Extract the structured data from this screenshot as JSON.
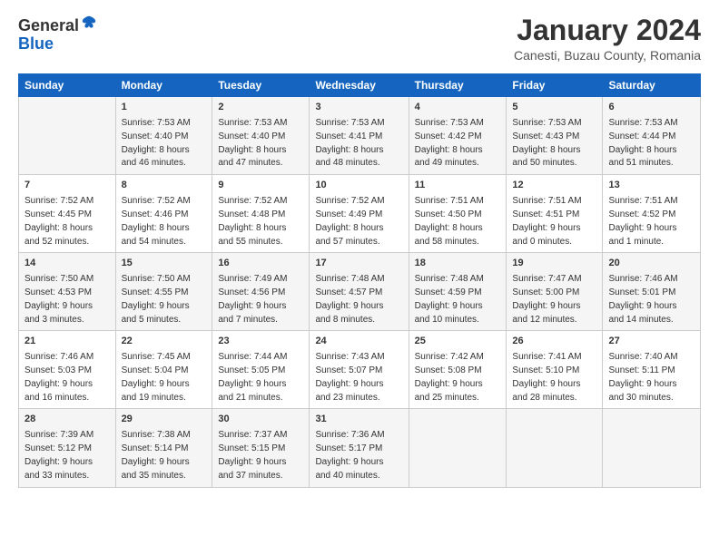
{
  "header": {
    "logo_line1": "General",
    "logo_line2": "Blue",
    "month": "January 2024",
    "location": "Canesti, Buzau County, Romania"
  },
  "days_of_week": [
    "Sunday",
    "Monday",
    "Tuesday",
    "Wednesday",
    "Thursday",
    "Friday",
    "Saturday"
  ],
  "weeks": [
    [
      {
        "day": "",
        "info": ""
      },
      {
        "day": "1",
        "info": "Sunrise: 7:53 AM\nSunset: 4:40 PM\nDaylight: 8 hours\nand 46 minutes."
      },
      {
        "day": "2",
        "info": "Sunrise: 7:53 AM\nSunset: 4:40 PM\nDaylight: 8 hours\nand 47 minutes."
      },
      {
        "day": "3",
        "info": "Sunrise: 7:53 AM\nSunset: 4:41 PM\nDaylight: 8 hours\nand 48 minutes."
      },
      {
        "day": "4",
        "info": "Sunrise: 7:53 AM\nSunset: 4:42 PM\nDaylight: 8 hours\nand 49 minutes."
      },
      {
        "day": "5",
        "info": "Sunrise: 7:53 AM\nSunset: 4:43 PM\nDaylight: 8 hours\nand 50 minutes."
      },
      {
        "day": "6",
        "info": "Sunrise: 7:53 AM\nSunset: 4:44 PM\nDaylight: 8 hours\nand 51 minutes."
      }
    ],
    [
      {
        "day": "7",
        "info": "Sunrise: 7:52 AM\nSunset: 4:45 PM\nDaylight: 8 hours\nand 52 minutes."
      },
      {
        "day": "8",
        "info": "Sunrise: 7:52 AM\nSunset: 4:46 PM\nDaylight: 8 hours\nand 54 minutes."
      },
      {
        "day": "9",
        "info": "Sunrise: 7:52 AM\nSunset: 4:48 PM\nDaylight: 8 hours\nand 55 minutes."
      },
      {
        "day": "10",
        "info": "Sunrise: 7:52 AM\nSunset: 4:49 PM\nDaylight: 8 hours\nand 57 minutes."
      },
      {
        "day": "11",
        "info": "Sunrise: 7:51 AM\nSunset: 4:50 PM\nDaylight: 8 hours\nand 58 minutes."
      },
      {
        "day": "12",
        "info": "Sunrise: 7:51 AM\nSunset: 4:51 PM\nDaylight: 9 hours\nand 0 minutes."
      },
      {
        "day": "13",
        "info": "Sunrise: 7:51 AM\nSunset: 4:52 PM\nDaylight: 9 hours\nand 1 minute."
      }
    ],
    [
      {
        "day": "14",
        "info": "Sunrise: 7:50 AM\nSunset: 4:53 PM\nDaylight: 9 hours\nand 3 minutes."
      },
      {
        "day": "15",
        "info": "Sunrise: 7:50 AM\nSunset: 4:55 PM\nDaylight: 9 hours\nand 5 minutes."
      },
      {
        "day": "16",
        "info": "Sunrise: 7:49 AM\nSunset: 4:56 PM\nDaylight: 9 hours\nand 7 minutes."
      },
      {
        "day": "17",
        "info": "Sunrise: 7:48 AM\nSunset: 4:57 PM\nDaylight: 9 hours\nand 8 minutes."
      },
      {
        "day": "18",
        "info": "Sunrise: 7:48 AM\nSunset: 4:59 PM\nDaylight: 9 hours\nand 10 minutes."
      },
      {
        "day": "19",
        "info": "Sunrise: 7:47 AM\nSunset: 5:00 PM\nDaylight: 9 hours\nand 12 minutes."
      },
      {
        "day": "20",
        "info": "Sunrise: 7:46 AM\nSunset: 5:01 PM\nDaylight: 9 hours\nand 14 minutes."
      }
    ],
    [
      {
        "day": "21",
        "info": "Sunrise: 7:46 AM\nSunset: 5:03 PM\nDaylight: 9 hours\nand 16 minutes."
      },
      {
        "day": "22",
        "info": "Sunrise: 7:45 AM\nSunset: 5:04 PM\nDaylight: 9 hours\nand 19 minutes."
      },
      {
        "day": "23",
        "info": "Sunrise: 7:44 AM\nSunset: 5:05 PM\nDaylight: 9 hours\nand 21 minutes."
      },
      {
        "day": "24",
        "info": "Sunrise: 7:43 AM\nSunset: 5:07 PM\nDaylight: 9 hours\nand 23 minutes."
      },
      {
        "day": "25",
        "info": "Sunrise: 7:42 AM\nSunset: 5:08 PM\nDaylight: 9 hours\nand 25 minutes."
      },
      {
        "day": "26",
        "info": "Sunrise: 7:41 AM\nSunset: 5:10 PM\nDaylight: 9 hours\nand 28 minutes."
      },
      {
        "day": "27",
        "info": "Sunrise: 7:40 AM\nSunset: 5:11 PM\nDaylight: 9 hours\nand 30 minutes."
      }
    ],
    [
      {
        "day": "28",
        "info": "Sunrise: 7:39 AM\nSunset: 5:12 PM\nDaylight: 9 hours\nand 33 minutes."
      },
      {
        "day": "29",
        "info": "Sunrise: 7:38 AM\nSunset: 5:14 PM\nDaylight: 9 hours\nand 35 minutes."
      },
      {
        "day": "30",
        "info": "Sunrise: 7:37 AM\nSunset: 5:15 PM\nDaylight: 9 hours\nand 37 minutes."
      },
      {
        "day": "31",
        "info": "Sunrise: 7:36 AM\nSunset: 5:17 PM\nDaylight: 9 hours\nand 40 minutes."
      },
      {
        "day": "",
        "info": ""
      },
      {
        "day": "",
        "info": ""
      },
      {
        "day": "",
        "info": ""
      }
    ]
  ]
}
